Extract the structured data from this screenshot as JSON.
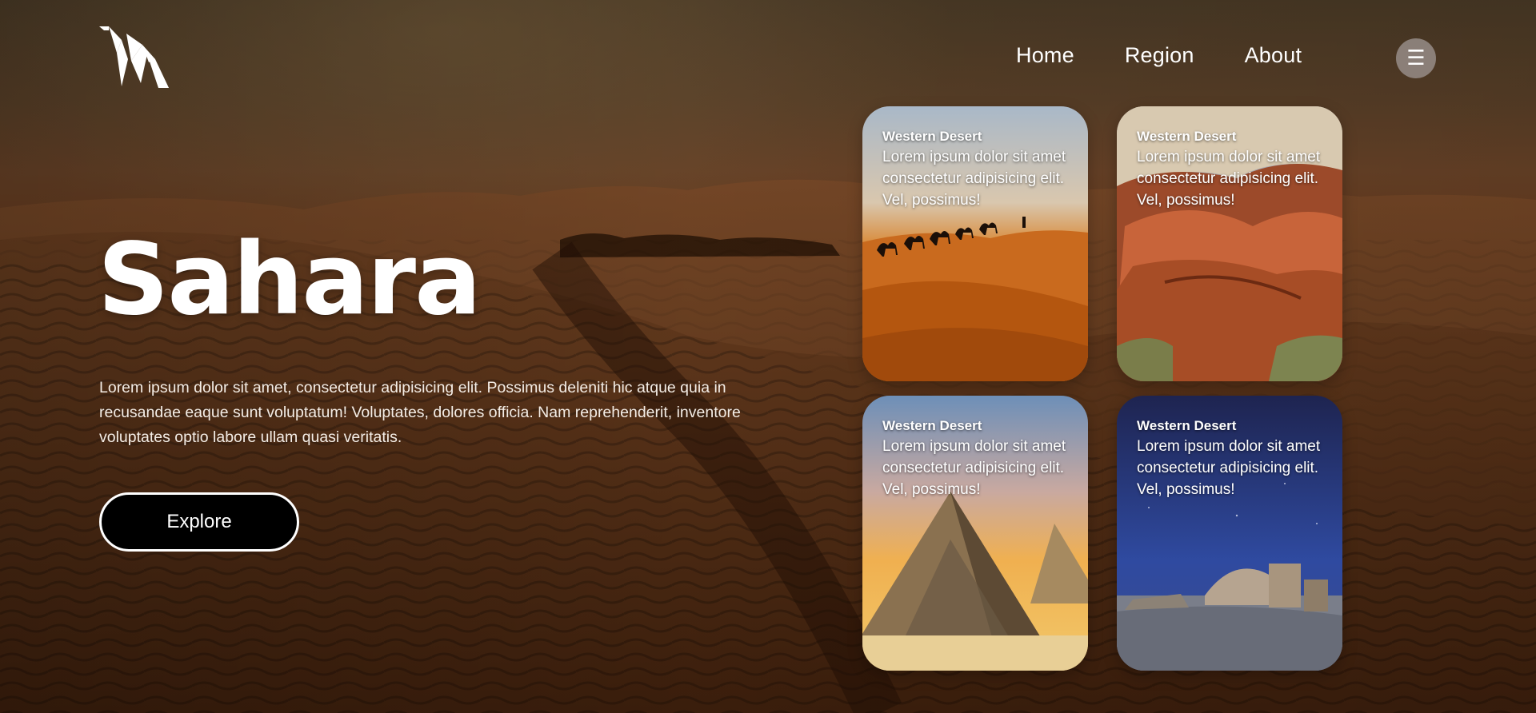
{
  "brand": {
    "logo_icon": "origami-camel-logo-icon"
  },
  "nav": {
    "items": [
      {
        "label": "Home"
      },
      {
        "label": "Region"
      },
      {
        "label": "About"
      }
    ],
    "menu_icon": "☰"
  },
  "hero": {
    "title": "Sahara",
    "description": "Lorem ipsum dolor sit amet, consectetur adipisicing elit. Possimus deleniti hic atque quia in recusandae eaque sunt voluptatum! Voluptates, dolores officia. Nam reprehenderit, inventore voluptates optio labore ullam quasi veritatis.",
    "cta_label": "Explore"
  },
  "cards": [
    {
      "heading": "Western Desert",
      "text": "Lorem ipsum dolor sit amet consectetur adipisicing elit. Vel, possimus!",
      "image": "camel-caravan-dunes"
    },
    {
      "heading": "Western Desert",
      "text": "Lorem ipsum dolor sit amet consectetur adipisicing elit. Vel, possimus!",
      "image": "red-rock-canyon"
    },
    {
      "heading": "Western Desert",
      "text": "Lorem ipsum dolor sit amet consectetur adipisicing elit. Vel, possimus!",
      "image": "pyramids-sunset"
    },
    {
      "heading": "Western Desert",
      "text": "Lorem ipsum dolor sit amet consectetur adipisicing elit. Vel, possimus!",
      "image": "desert-ruins-night-sky"
    }
  ],
  "colors": {
    "sand_dark": "#3f200e",
    "sand_mid": "#6a3c1e",
    "button_bg": "#000000",
    "menu_bg": "#968c87"
  }
}
